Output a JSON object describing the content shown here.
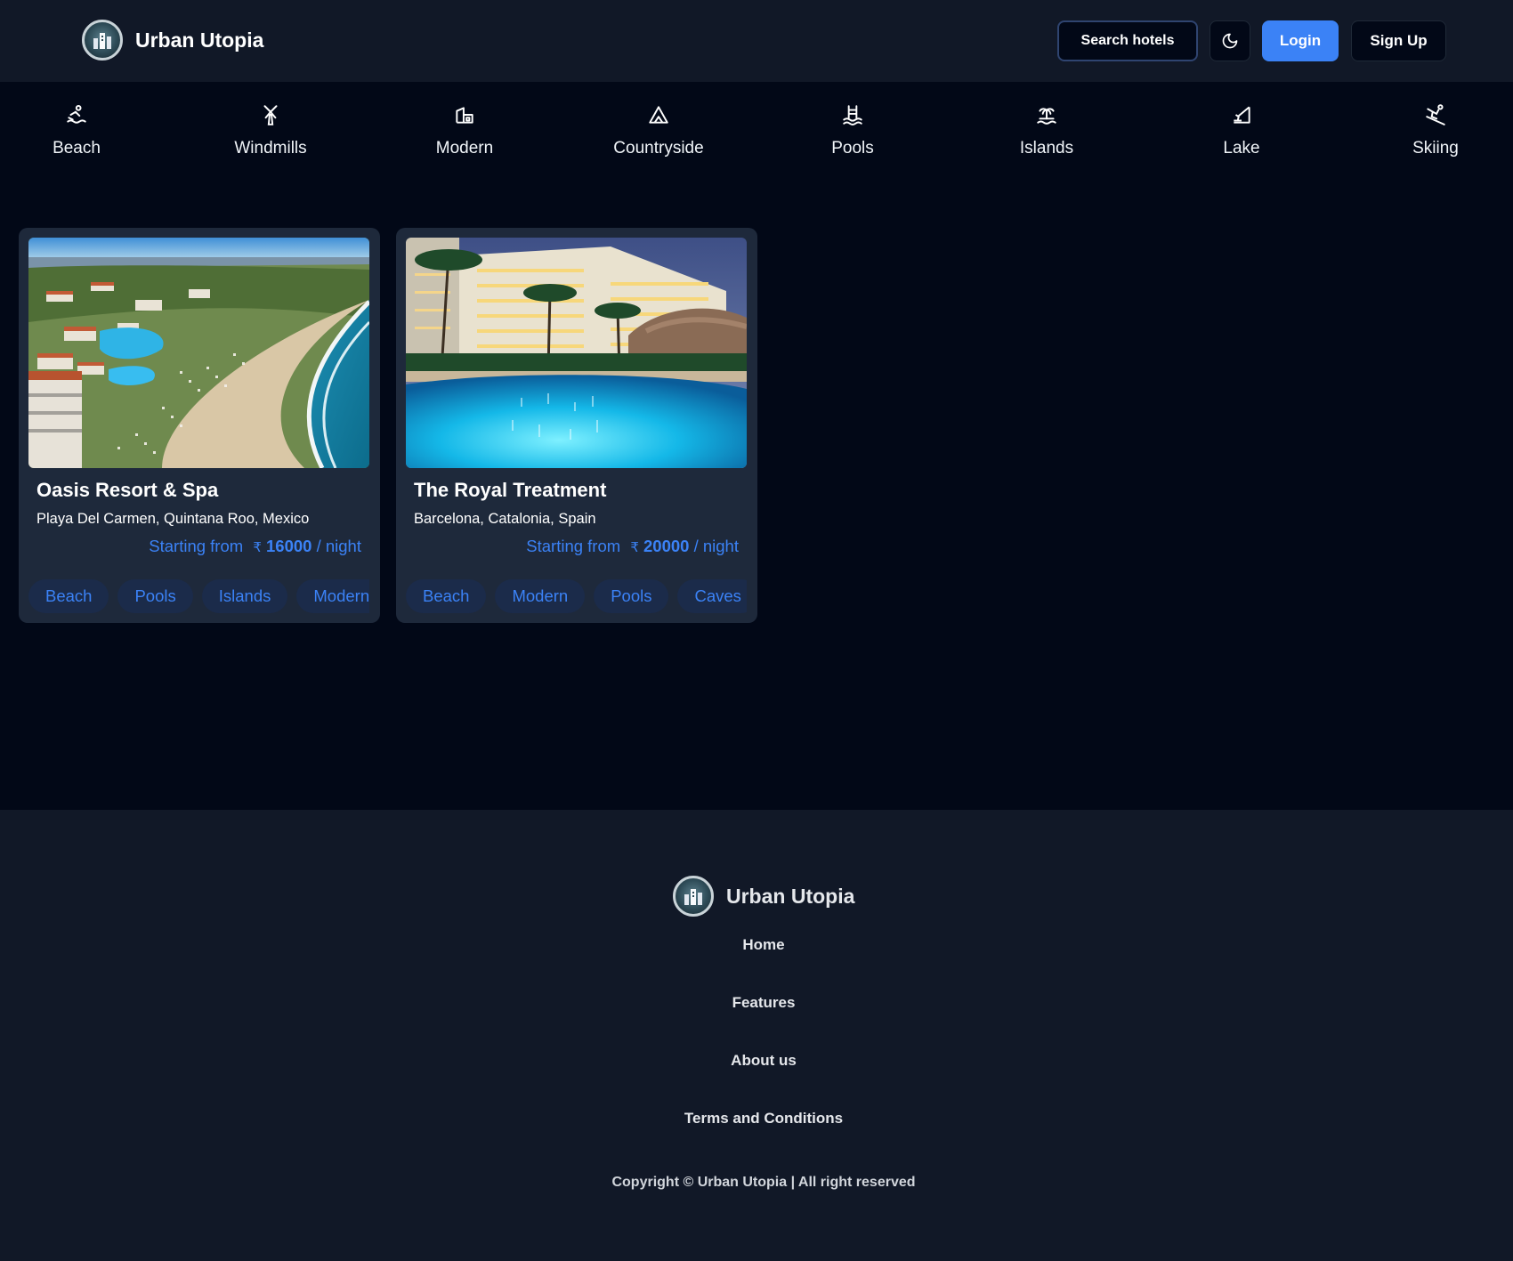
{
  "header": {
    "brand": "Urban Utopia",
    "search_button": "Search hotels",
    "theme_toggle_icon": "moon-icon",
    "login_button": "Login",
    "signup_button": "Sign Up"
  },
  "categories": [
    {
      "label": "Beach",
      "icon": "beach-icon"
    },
    {
      "label": "Windmills",
      "icon": "windmill-icon"
    },
    {
      "label": "Modern",
      "icon": "modern-house-icon"
    },
    {
      "label": "Countryside",
      "icon": "mountain-icon"
    },
    {
      "label": "Pools",
      "icon": "pool-icon"
    },
    {
      "label": "Islands",
      "icon": "island-icon"
    },
    {
      "label": "Lake",
      "icon": "lake-icon"
    },
    {
      "label": "Skiing",
      "icon": "skiing-icon"
    }
  ],
  "hotels": [
    {
      "name": "Oasis Resort & Spa",
      "location": "Playa Del Carmen, Quintana Roo, Mexico",
      "price_prefix": "Starting from",
      "currency": "₹",
      "price": "16000",
      "price_suffix": "/ night",
      "tags": [
        "Beach",
        "Pools",
        "Islands",
        "Modern"
      ]
    },
    {
      "name": "The Royal Treatment",
      "location": "Barcelona, Catalonia, Spain",
      "price_prefix": "Starting from",
      "currency": "₹",
      "price": "20000",
      "price_suffix": "/ night",
      "tags": [
        "Beach",
        "Modern",
        "Pools",
        "Caves"
      ]
    }
  ],
  "footer": {
    "brand": "Urban Utopia",
    "links": [
      "Home",
      "Features",
      "About us",
      "Terms and Conditions"
    ],
    "copyright": "Copyright © Urban Utopia | All right reserved"
  },
  "colors": {
    "page_background": "#020817",
    "header_background": "#111827",
    "card_background": "#1e293b",
    "accent": "#3b82f6"
  }
}
